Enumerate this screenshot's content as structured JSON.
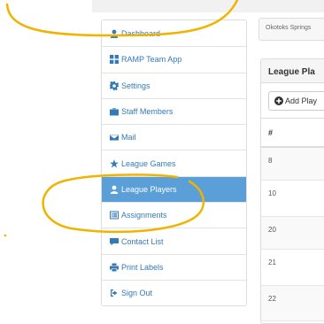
{
  "breadcrumb": {
    "text": "Okotoks Springs"
  },
  "menu": {
    "items": [
      {
        "label": "Dashboard",
        "icon": "user-icon"
      },
      {
        "label": "RAMP Team App",
        "icon": "grid-icon"
      },
      {
        "label": "Settings",
        "icon": "gear-icon"
      },
      {
        "label": "Staff Members",
        "icon": "briefcase-icon"
      },
      {
        "label": "Mail",
        "icon": "envelope-icon"
      },
      {
        "label": "League Games",
        "icon": "star-icon"
      },
      {
        "label": "League Players",
        "icon": "user-icon",
        "active": true
      },
      {
        "label": "Assignments",
        "icon": "list-icon"
      },
      {
        "label": "Contact List",
        "icon": "comment-icon"
      },
      {
        "label": "Print Labels",
        "icon": "print-icon"
      },
      {
        "label": "Sign Out",
        "icon": "sign-out-icon"
      }
    ]
  },
  "panel": {
    "title": "League Pla",
    "add_button_label": "Add Play",
    "table": {
      "header": "#",
      "rows": [
        "8",
        "10",
        "20",
        "21",
        "22"
      ]
    }
  },
  "colors": {
    "link": "#337ab7",
    "active_bg": "#5b9fd8",
    "annotation": "#f0b400"
  }
}
